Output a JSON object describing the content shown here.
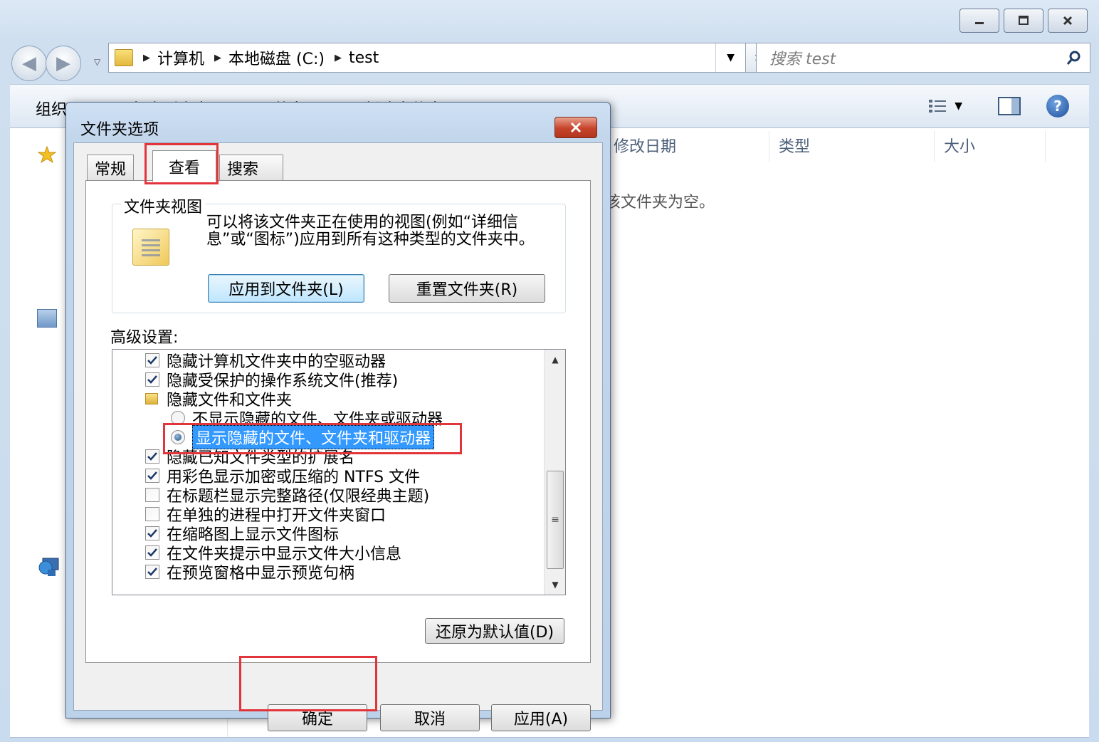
{
  "explorer": {
    "window_controls": {
      "minimize": "minimize",
      "maximize": "maximize",
      "close": "close"
    },
    "breadcrumbs": [
      "计算机",
      "本地磁盘 (C:)",
      "test"
    ],
    "search_placeholder": "搜索 test",
    "toolbar": {
      "organize": "组织",
      "include_in_library": "包含到库中",
      "share": "共享",
      "new_folder": "新建文件夹"
    },
    "columns": [
      "修改日期",
      "类型",
      "大小"
    ],
    "empty_message": "该文件夹为空。"
  },
  "dialog": {
    "title": "文件夹选项",
    "tabs": [
      {
        "label": "常规",
        "active": false
      },
      {
        "label": "查看",
        "active": true
      },
      {
        "label": "搜索",
        "active": false
      }
    ],
    "folder_views": {
      "label": "文件夹视图",
      "description": "可以将该文件夹正在使用的视图(例如“详细信息”或“图标”)应用到所有这种类型的文件夹中。",
      "apply_button": "应用到文件夹(L)",
      "reset_button": "重置文件夹(R)"
    },
    "advanced_label": "高级设置:",
    "advanced_items": [
      {
        "type": "checkbox",
        "checked": true,
        "label": "隐藏计算机文件夹中的空驱动器"
      },
      {
        "type": "checkbox",
        "checked": true,
        "label": "隐藏受保护的操作系统文件(推荐)"
      },
      {
        "type": "folder",
        "label": "隐藏文件和文件夹"
      },
      {
        "type": "radio",
        "checked": false,
        "label": "不显示隐藏的文件、文件夹或驱动器"
      },
      {
        "type": "radio",
        "checked": true,
        "label": "显示隐藏的文件、文件夹和驱动器"
      },
      {
        "type": "checkbox",
        "checked": true,
        "label": "隐藏已知文件类型的扩展名"
      },
      {
        "type": "checkbox",
        "checked": true,
        "label": "用彩色显示加密或压缩的 NTFS 文件"
      },
      {
        "type": "checkbox",
        "checked": false,
        "label": "在标题栏显示完整路径(仅限经典主题)"
      },
      {
        "type": "checkbox",
        "checked": false,
        "label": "在单独的进程中打开文件夹窗口"
      },
      {
        "type": "checkbox",
        "checked": true,
        "label": "在缩略图上显示文件图标"
      },
      {
        "type": "checkbox",
        "checked": true,
        "label": "在文件夹提示中显示文件大小信息"
      },
      {
        "type": "checkbox",
        "checked": true,
        "label": "在预览窗格中显示预览句柄"
      }
    ],
    "restore_defaults": "还原为默认值(D)",
    "ok": "确定",
    "cancel": "取消",
    "apply": "应用(A)"
  },
  "colors": {
    "highlight_box": "#e2353b",
    "selection": "#3399ff",
    "close_button": "#c6432a"
  }
}
